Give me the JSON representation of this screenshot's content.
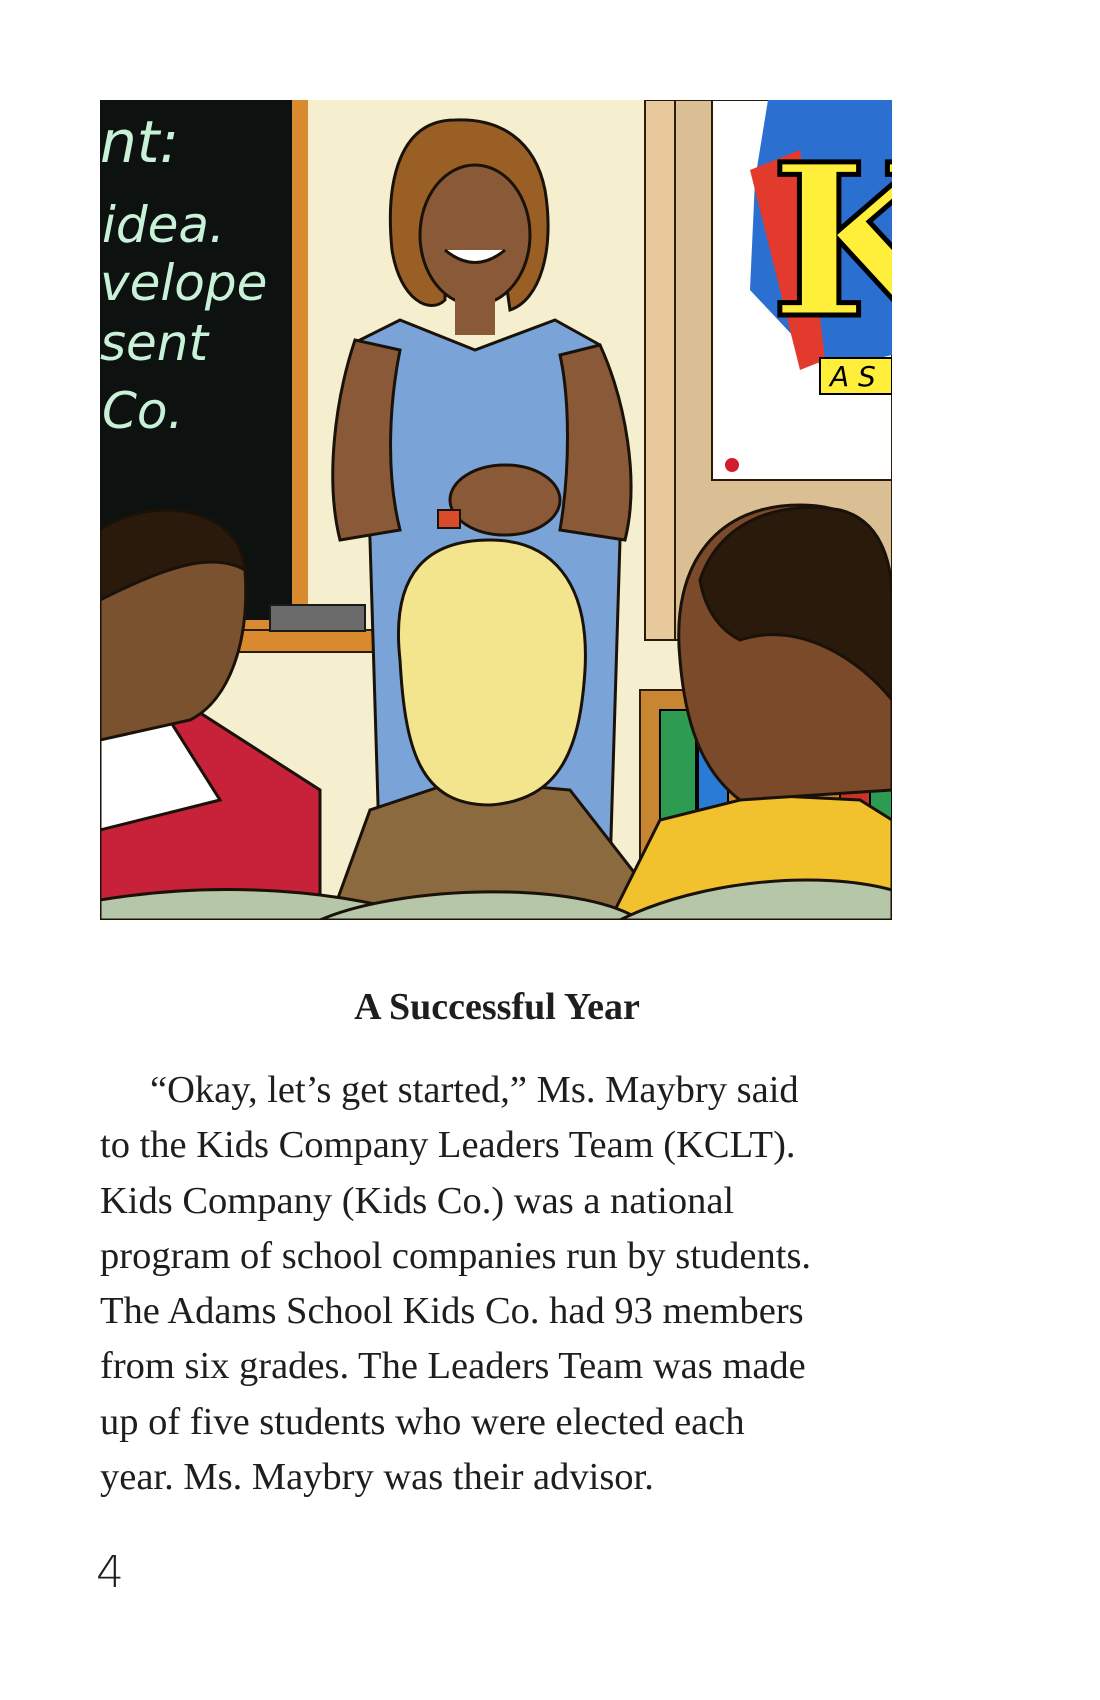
{
  "illustration": {
    "icon": "classroom-illustration",
    "chalkboard_lines": [
      "nt:",
      "idea.",
      "velope",
      "sent",
      "Co."
    ],
    "poster_letter": "K",
    "poster_subtext": "A S",
    "colors": {
      "board": "#0d1210",
      "wall": "#f6efcf",
      "teacher_dress": "#7aa3d8",
      "poster_yellow": "#ffef3a",
      "poster_red": "#e23b2e",
      "poster_blue": "#2b6fd1"
    }
  },
  "section": {
    "title": "A Successful Year"
  },
  "story": {
    "lines": [
      "“Okay, let’s get started,” Ms. Maybry said",
      "to the Kids Company Leaders Team (KCLT).",
      "Kids Company (Kids Co.) was a national",
      "program of school companies run by students.",
      "The Adams School Kids Co. had 93 members",
      "from six grades. The Leaders Team was made",
      "up of five students who were elected each",
      "year. Ms. Maybry was their advisor."
    ]
  },
  "page": {
    "number": "4"
  }
}
